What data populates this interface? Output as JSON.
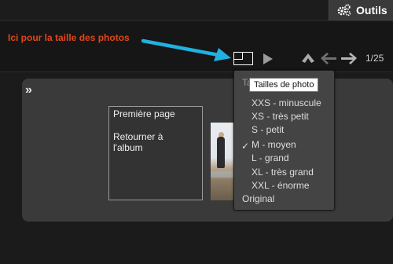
{
  "toolbar": {
    "tools_label": "Outils"
  },
  "annotation": {
    "text": "Ici pour la taille des photos",
    "color": "#e2461b",
    "arrow_color": "#1fb2e0"
  },
  "nav": {
    "counter": "1/25"
  },
  "panel": {
    "expand_glyph": "»",
    "first_page": "Première page",
    "back_line1": "Retourner à",
    "back_line2": "l'album"
  },
  "dropdown": {
    "header": "Ta",
    "tooltip": "Tailles de photo",
    "items": [
      "XXS - minuscule",
      "XS - très petit",
      "S - petit",
      "M - moyen",
      "L - grand",
      "XL - très grand",
      "XXL - énorme",
      "Original"
    ],
    "selected": "M - moyen",
    "check": "✓"
  },
  "icons": {
    "tools": "gears-icon",
    "size": "photo-size-icon",
    "play": "play-icon",
    "up": "up-arrow-icon",
    "prev": "left-arrow-icon",
    "next": "right-arrow-icon"
  }
}
